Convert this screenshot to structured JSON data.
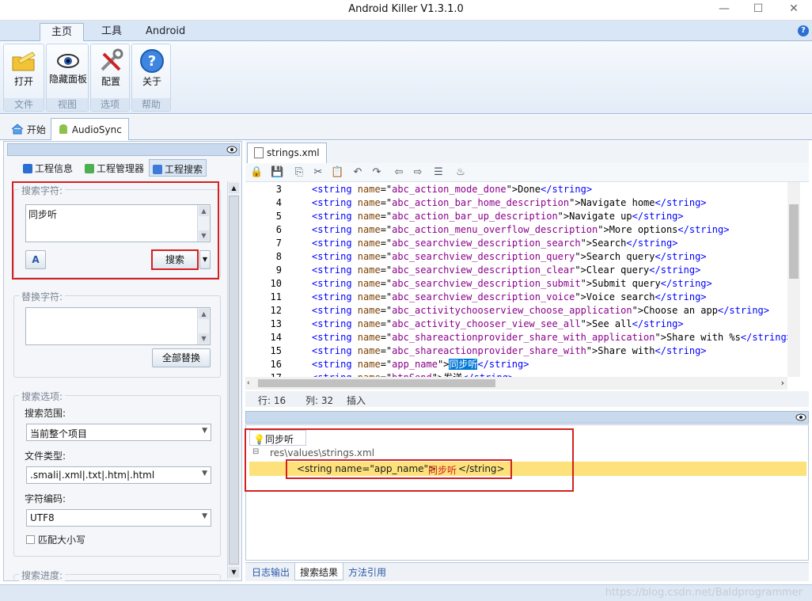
{
  "window": {
    "title": "Android Killer V1.3.1.0",
    "min": "—",
    "max": "☐",
    "close": "✕"
  },
  "ribbon_tabs": [
    "主页",
    "工具",
    "Android"
  ],
  "help": "?",
  "ribbon": {
    "groups": [
      {
        "label": "文件",
        "buttons": [
          {
            "label": "打开",
            "icon": "open-folder-icon"
          }
        ]
      },
      {
        "label": "视图",
        "buttons": [
          {
            "label": "隐藏面板",
            "icon": "eye-icon"
          }
        ]
      },
      {
        "label": "选项",
        "buttons": [
          {
            "label": "配置",
            "icon": "tools-icon"
          }
        ]
      },
      {
        "label": "帮助",
        "buttons": [
          {
            "label": "关于",
            "icon": "help-icon"
          }
        ]
      }
    ]
  },
  "doc_tabs": [
    {
      "label": "开始",
      "icon": "home-icon"
    },
    {
      "label": "AudioSync",
      "icon": "android-icon"
    }
  ],
  "left_panel": {
    "tabs": [
      "工程信息",
      "工程管理器",
      "工程搜索"
    ],
    "search": {
      "legend": "搜索字符:",
      "value": "同步听",
      "button": "搜索"
    },
    "replace": {
      "legend": "替换字符:",
      "value": "",
      "button": "全部替换"
    },
    "options": {
      "legend": "搜索选项:",
      "scope_label": "搜索范围:",
      "scope_value": "当前整个项目",
      "filetype_label": "文件类型:",
      "filetype_value": ".smali|.xml|.txt|.htm|.html",
      "encoding_label": "字符编码:",
      "encoding_value": "UTF8",
      "match_case": "匹配大小写"
    },
    "progress_legend": "搜索进度:"
  },
  "editor": {
    "tab": "strings.xml",
    "lines": [
      {
        "n": "3",
        "name": "abc_action_mode_done",
        "text": "Done"
      },
      {
        "n": "4",
        "name": "abc_action_bar_home_description",
        "text": "Navigate home"
      },
      {
        "n": "5",
        "name": "abc_action_bar_up_description",
        "text": "Navigate up"
      },
      {
        "n": "6",
        "name": "abc_action_menu_overflow_description",
        "text": "More options"
      },
      {
        "n": "7",
        "name": "abc_searchview_description_search",
        "text": "Search"
      },
      {
        "n": "8",
        "name": "abc_searchview_description_query",
        "text": "Search query"
      },
      {
        "n": "9",
        "name": "abc_searchview_description_clear",
        "text": "Clear query"
      },
      {
        "n": "10",
        "name": "abc_searchview_description_submit",
        "text": "Submit query"
      },
      {
        "n": "11",
        "name": "abc_searchview_description_voice",
        "text": "Voice search"
      },
      {
        "n": "12",
        "name": "abc_activitychooserview_choose_application",
        "text": "Choose an app"
      },
      {
        "n": "13",
        "name": "abc_activity_chooser_view_see_all",
        "text": "See all"
      },
      {
        "n": "14",
        "name": "abc_shareactionprovider_share_with_application",
        "text": "Share with %s"
      },
      {
        "n": "15",
        "name": "abc_shareactionprovider_share_with",
        "text": "Share with"
      },
      {
        "n": "16",
        "name": "app_name",
        "text": "同步听",
        "highlight": true
      },
      {
        "n": "17",
        "name": "btnSend",
        "text": "发送"
      }
    ],
    "status": {
      "line": "行: 16",
      "col": "列: 32",
      "mode": "插入"
    }
  },
  "results": {
    "root": "同步听",
    "file": "res\\values\\strings.xml",
    "match_prefix": "<string name=\"app_name\">",
    "match_text": "同步听",
    "match_suffix": " </string>"
  },
  "bottom_tabs": [
    "日志输出",
    "搜索结果",
    "方法引用"
  ],
  "watermark": "https://blog.csdn.net/Baldprogrammer"
}
